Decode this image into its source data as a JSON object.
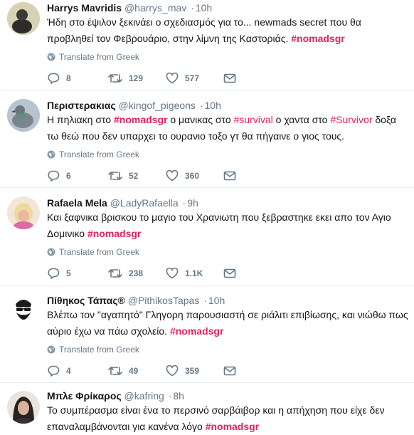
{
  "tweets": [
    {
      "name": "Harrys Mavridis",
      "handle": "@harrys_mav",
      "sep": "·",
      "time": "10h",
      "text_parts": [
        "Ήδη στο έψιλον ξεκινάει ο σχεδιασμός για το... newmads secret που θα προβληθεί τον Φεβρουάριο, στην λίμνη της Καστοριάς. ",
        "#nomadsgr"
      ],
      "translate": "Translate from Greek",
      "replies": "8",
      "retweets": "129",
      "likes": "577"
    },
    {
      "name": "Περιστερακιας",
      "handle": "@kingof_pigeons",
      "sep": "·",
      "time": "10h",
      "text_parts": [
        "Η πηλιακη στο ",
        "#nomadsgr",
        " ο μανικας στο ",
        "#survival",
        " ο χαντα στο ",
        "#Survivor",
        " δοξα τω θεώ που δεν υπαρχει το ουρανιο τοξο γτ θα πήγαινε ο γιος τους."
      ],
      "translate": "Translate from Greek",
      "replies": "6",
      "retweets": "52",
      "likes": "360"
    },
    {
      "name": "Rafaela Mela",
      "handle": "@LadyRafaella",
      "sep": "·",
      "time": "9h",
      "text_parts": [
        "Και ξαφνικα βρισκου το μαγιο του Χρανιωτη που ξεβραστηκε εκει απο τον Αγιο Δομινικο ",
        "#nomadsgr"
      ],
      "translate": "Translate from Greek",
      "replies": "5",
      "retweets": "238",
      "likes": "1.1K"
    },
    {
      "name": "Πίθηκος Τάπας®",
      "handle": "@PithikosTapas",
      "sep": "·",
      "time": "10h",
      "text_parts": [
        "Βλέπω τον \"αγαπητό\" Γληγορη παρουσιαστή σε ριάλιτι επιβίωσης, και νιώθω πως αύριο έχω να πάω σχολείο. ",
        "#nomadsgr"
      ],
      "translate": "Translate from Greek",
      "replies": "4",
      "retweets": "49",
      "likes": "359"
    },
    {
      "name": "Μπλε Φρίκαρος",
      "handle": "@kafring",
      "sep": "·",
      "time": "8h",
      "text_parts": [
        "Το συμπέρασμα είναι ένα το περσινό σαρβάιβορ και η απήχηση που είχε δεν επαναλαμβάνονται για κανένα λόγο ",
        "#nomadsgr"
      ]
    }
  ],
  "colors": {
    "hashtag": "#e0245e",
    "muted": "#657786",
    "divider": "#e6ecf0"
  },
  "icons": [
    "reply-icon",
    "retweet-icon",
    "like-icon",
    "direct-message-icon",
    "globe-icon"
  ]
}
